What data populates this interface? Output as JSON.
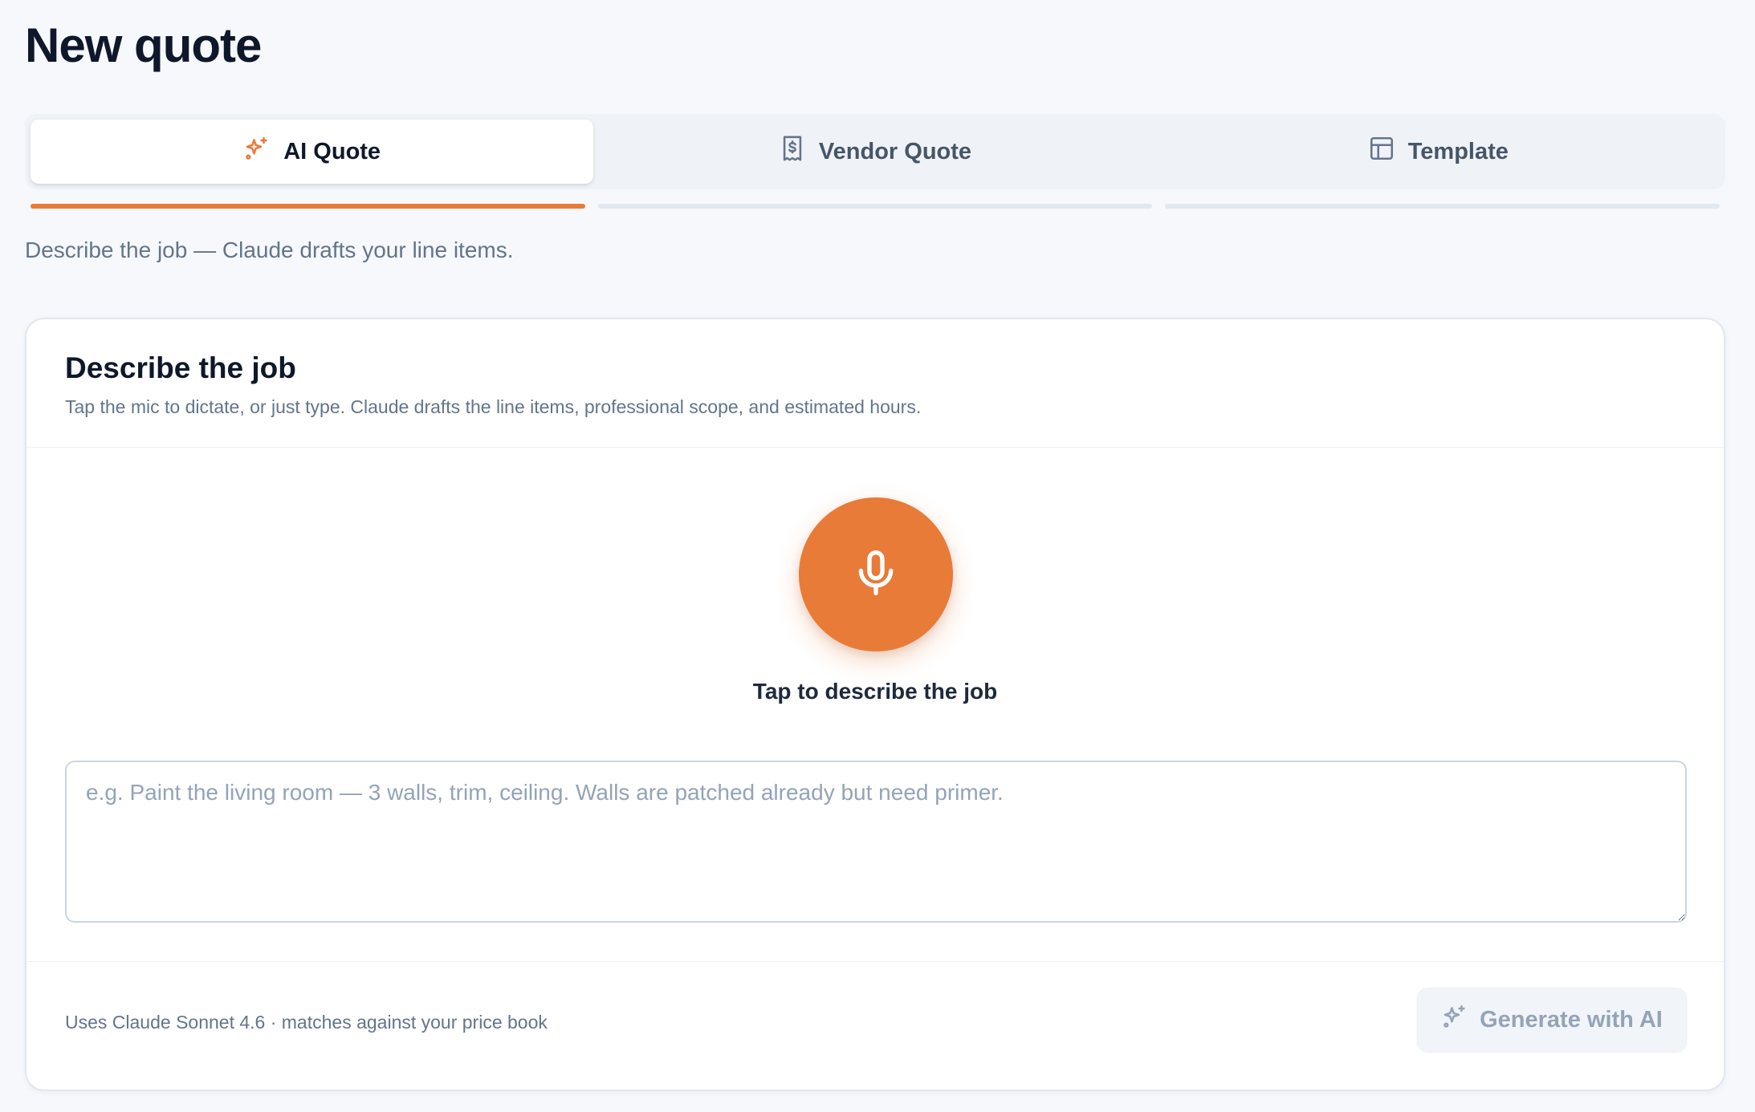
{
  "page": {
    "title": "New quote",
    "subtitle": "Describe the job — Claude drafts your line items."
  },
  "tabs": [
    {
      "label": "AI Quote",
      "icon": "sparkles-icon",
      "active": true
    },
    {
      "label": "Vendor Quote",
      "icon": "receipt-dollar-icon",
      "active": false
    },
    {
      "label": "Template",
      "icon": "layout-template-icon",
      "active": false
    }
  ],
  "card": {
    "title": "Describe the job",
    "description": "Tap the mic to dictate, or just type. Claude drafts the line items, professional scope, and estimated hours.",
    "mic": {
      "icon": "microphone-icon",
      "label": "Tap to describe the job"
    },
    "textarea": {
      "value": "",
      "placeholder": "e.g. Paint the living room — 3 walls, trim, ceiling. Walls are patched already but need primer."
    },
    "footer_note": "Uses Claude Sonnet 4.6 · matches against your price book",
    "generate_button": {
      "label": "Generate with AI",
      "icon": "sparkles-icon",
      "disabled": true
    }
  },
  "colors": {
    "accent": "#e87b37",
    "background": "#f6f8fb",
    "text_primary": "#0f172a",
    "text_muted": "#64748b",
    "disabled_text": "#94a3b8"
  }
}
